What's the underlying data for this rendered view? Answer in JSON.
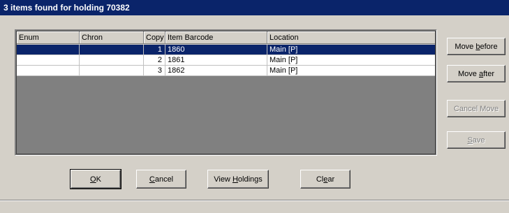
{
  "window": {
    "title": "3 items found for holding 70382"
  },
  "table": {
    "columns": [
      "Enum",
      "Chron",
      "Copy",
      "Item Barcode",
      "Location"
    ],
    "rows": [
      {
        "enum": "",
        "chron": "",
        "copy": "1",
        "barcode": "1860",
        "location": "Main [P]",
        "selected": true
      },
      {
        "enum": "",
        "chron": "",
        "copy": "2",
        "barcode": "1861",
        "location": "Main [P]",
        "selected": false
      },
      {
        "enum": "",
        "chron": "",
        "copy": "3",
        "barcode": "1862",
        "location": "Main [P]",
        "selected": false
      }
    ]
  },
  "side_buttons": {
    "move_before": {
      "pre": "Move ",
      "key": "b",
      "post": "efore"
    },
    "move_after": {
      "pre": "Move ",
      "key": "a",
      "post": "fter"
    },
    "cancel_move": "Cancel Move",
    "save": {
      "pre": "",
      "key": "S",
      "post": "ave"
    }
  },
  "bottom_buttons": {
    "ok": {
      "pre": "",
      "key": "O",
      "post": "K"
    },
    "cancel": {
      "pre": "",
      "key": "C",
      "post": "ancel"
    },
    "view_holdings": {
      "pre": "View ",
      "key": "H",
      "post": "oldings"
    },
    "clear": {
      "pre": "Cl",
      "key": "e",
      "post": "ar"
    }
  },
  "colors": {
    "titlebar": "#0a246a",
    "selection": "#0a246a",
    "grid_bg": "#808080",
    "face": "#d4d0c8"
  }
}
